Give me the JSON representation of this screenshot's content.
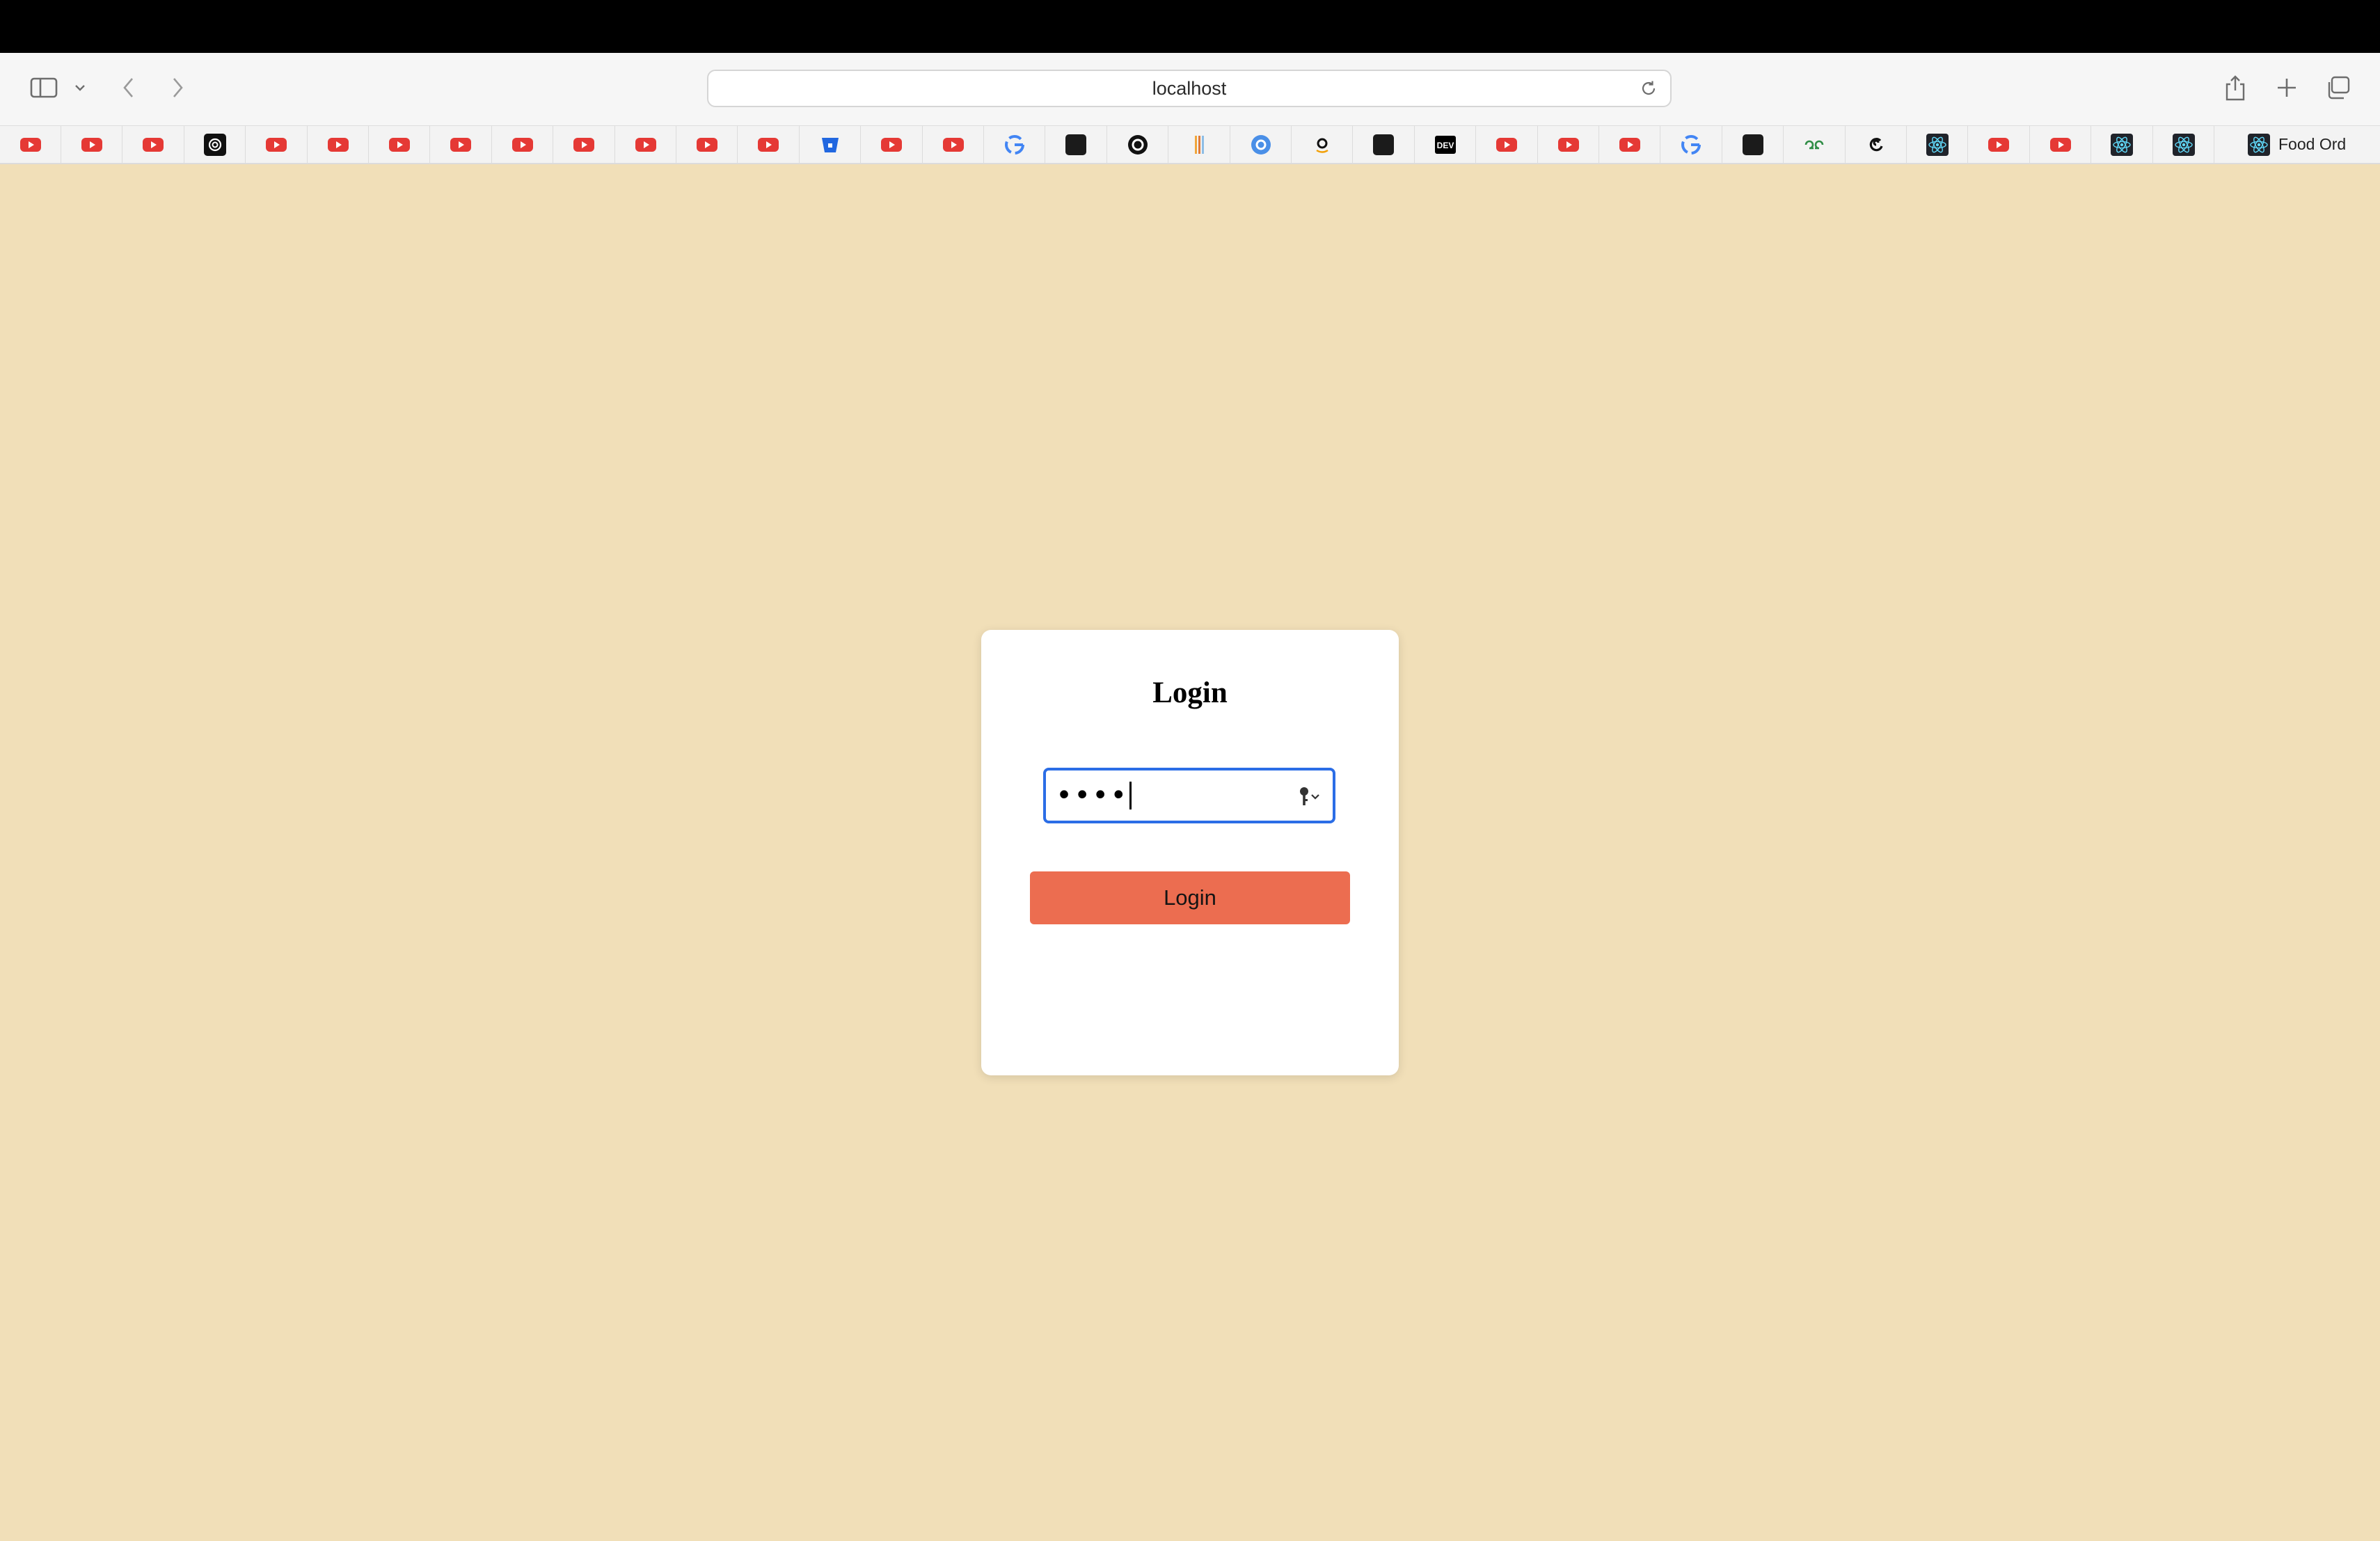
{
  "browser": {
    "address": "localhost",
    "bookmarks": [
      {
        "icon": "youtube-icon"
      },
      {
        "icon": "youtube-icon"
      },
      {
        "icon": "youtube-icon"
      },
      {
        "icon": "openai-icon"
      },
      {
        "icon": "youtube-icon"
      },
      {
        "icon": "youtube-icon"
      },
      {
        "icon": "youtube-icon"
      },
      {
        "icon": "youtube-icon"
      },
      {
        "icon": "youtube-icon"
      },
      {
        "icon": "youtube-icon"
      },
      {
        "icon": "youtube-icon"
      },
      {
        "icon": "youtube-icon"
      },
      {
        "icon": "youtube-icon"
      },
      {
        "icon": "bitbucket-icon"
      },
      {
        "icon": "youtube-icon"
      },
      {
        "icon": "youtube-icon"
      },
      {
        "icon": "google-icon"
      },
      {
        "icon": "dark-square-icon"
      },
      {
        "icon": "circle-logo-icon"
      },
      {
        "icon": "stripes-icon"
      },
      {
        "icon": "blue-circle-icon"
      },
      {
        "icon": "amazon-icon"
      },
      {
        "icon": "dark-square-icon"
      },
      {
        "icon": "dev-icon",
        "text": "DEV"
      },
      {
        "icon": "youtube-icon"
      },
      {
        "icon": "youtube-icon"
      },
      {
        "icon": "youtube-icon"
      },
      {
        "icon": "google-icon"
      },
      {
        "icon": "dark-square-icon"
      },
      {
        "icon": "geeksforgeeks-icon"
      },
      {
        "icon": "spiral-icon"
      },
      {
        "icon": "react-icon"
      },
      {
        "icon": "youtube-icon"
      },
      {
        "icon": "youtube-icon"
      },
      {
        "icon": "react-icon"
      },
      {
        "icon": "react-icon"
      }
    ],
    "last_bookmark": {
      "icon": "react-icon",
      "label": "Food Ord"
    }
  },
  "login": {
    "title": "Login",
    "password_value": "••••",
    "button_label": "Login"
  },
  "colors": {
    "page_background": "#f1dfb8",
    "button": "#ec6d50",
    "input_focus": "#2b6de6"
  }
}
